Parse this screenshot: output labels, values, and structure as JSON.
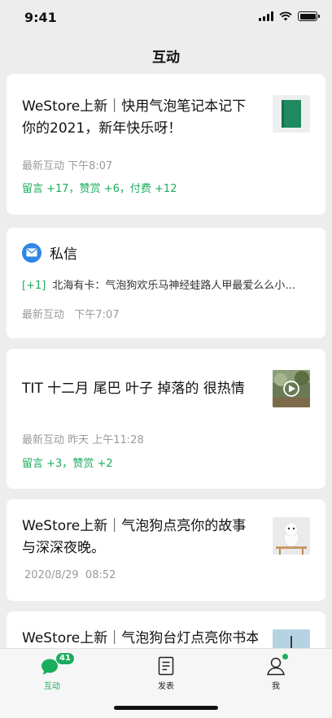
{
  "status": {
    "time": "9:41"
  },
  "nav": {
    "title": "互动"
  },
  "cards": [
    {
      "title": "WeStore上新｜快用气泡笔记本记下你的2021，新年快乐呀！",
      "meta": "最新互动 下午8:07",
      "stats": [
        "留言 +17",
        "赞赏 +6",
        "付费 +12"
      ]
    },
    {
      "title": "TIT 十二月 尾巴 叶子 掉落的 很热情",
      "meta": "最新互动 昨天 上午11:28",
      "stats": [
        "留言 +3",
        "赞赏 +2"
      ]
    },
    {
      "title": "WeStore上新｜气泡狗点亮你的故事与深深夜晚。",
      "meta": "2020/8/29  08:52"
    },
    {
      "title": "WeStore上新｜气泡狗台灯点亮你书本"
    }
  ],
  "message": {
    "title": "私信",
    "badge": "[+1]",
    "preview": "北海有卡：气泡狗欢乐马神经蛙路人甲最爱么么小…",
    "meta": "最新互动   下午7:07"
  },
  "tabbar": {
    "items": [
      {
        "label": "互动",
        "badge": "41"
      },
      {
        "label": "发表"
      },
      {
        "label": "我"
      }
    ]
  },
  "colors": {
    "accent": "#1aad5c",
    "mail": "#2f86e6",
    "background": "#ededed"
  }
}
